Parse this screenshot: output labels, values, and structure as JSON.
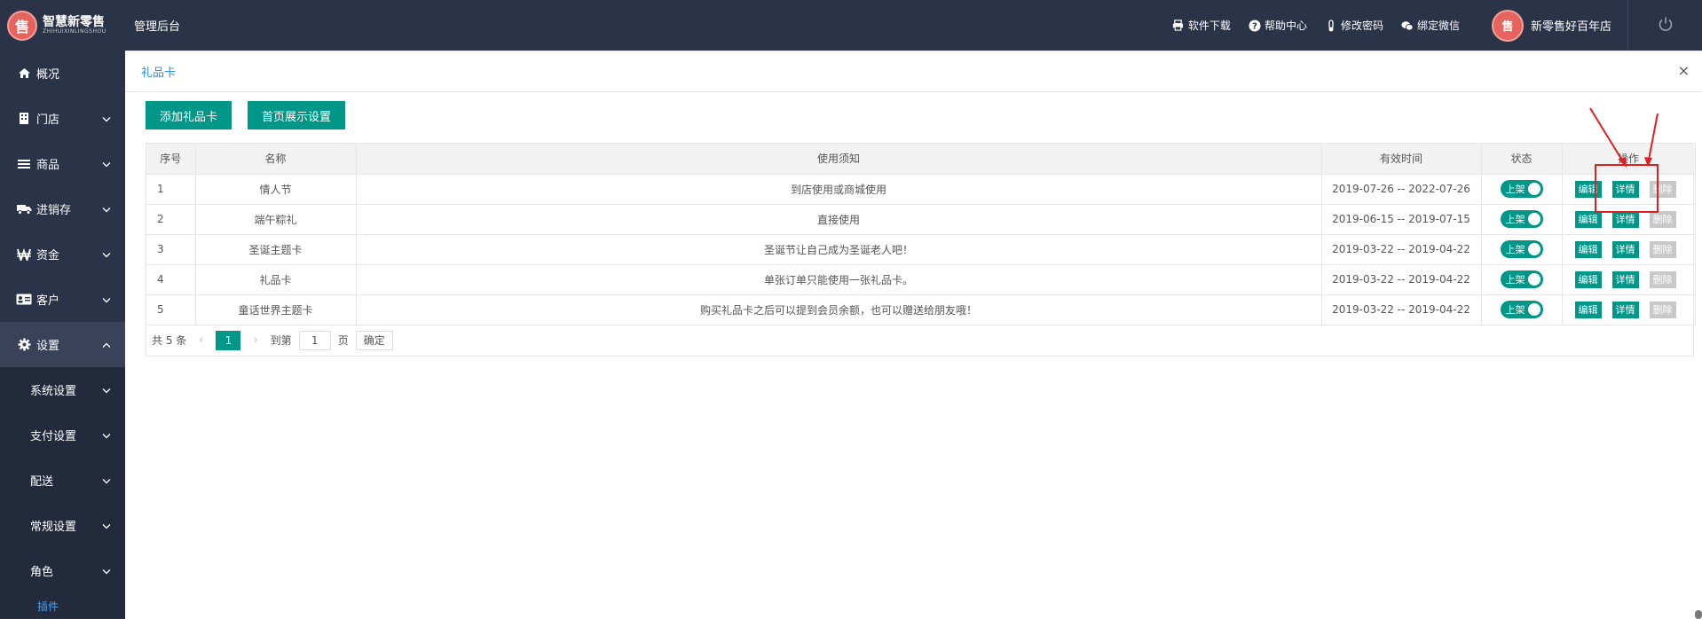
{
  "header": {
    "brand_name": "智慧新零售",
    "brand_sub": "ZHIHUIXINLINGSHOU",
    "logo_glyph": "售",
    "title": "管理后台",
    "links": [
      {
        "label": "软件下载",
        "icon": "printer-icon"
      },
      {
        "label": "帮助中心",
        "icon": "help-icon"
      },
      {
        "label": "修改密码",
        "icon": "thermometer-icon"
      },
      {
        "label": "绑定微信",
        "icon": "wechat-icon"
      }
    ],
    "shop_name": "新零售好百年店"
  },
  "sidebar": {
    "items": [
      {
        "label": "概况",
        "icon": "home-icon"
      },
      {
        "label": "门店",
        "icon": "building-icon"
      },
      {
        "label": "商品",
        "icon": "list-icon"
      },
      {
        "label": "进销存",
        "icon": "truck-icon"
      },
      {
        "label": "资金",
        "icon": "won-icon"
      },
      {
        "label": "客户",
        "icon": "id-card-icon"
      },
      {
        "label": "设置",
        "icon": "gear-icon"
      }
    ],
    "sub_items": [
      {
        "label": "系统设置"
      },
      {
        "label": "支付设置"
      },
      {
        "label": "配送"
      },
      {
        "label": "常规设置"
      },
      {
        "label": "角色"
      }
    ],
    "leaf": "插件"
  },
  "page": {
    "title": "礼品卡",
    "close": "×",
    "buttons": {
      "add": "添加礼品卡",
      "home_display": "首页展示设置"
    }
  },
  "table": {
    "headers": [
      "序号",
      "名称",
      "使用须知",
      "有效时间",
      "状态",
      "操作"
    ],
    "rows": [
      {
        "no": "1",
        "name": "情人节",
        "notice": "到店使用或商城使用",
        "valid": "2019-07-26 -- 2022-07-26",
        "status": "上架"
      },
      {
        "no": "2",
        "name": "端午粽礼",
        "notice": "直接使用",
        "valid": "2019-06-15 -- 2019-07-15",
        "status": "上架"
      },
      {
        "no": "3",
        "name": "圣诞主题卡",
        "notice": "圣诞节让自己成为圣诞老人吧！",
        "valid": "2019-03-22 -- 2019-04-22",
        "status": "上架"
      },
      {
        "no": "4",
        "name": "礼品卡",
        "notice": "单张订单只能使用一张礼品卡。",
        "valid": "2019-03-22 -- 2019-04-22",
        "status": "上架"
      },
      {
        "no": "5",
        "name": "童话世界主题卡",
        "notice": "购买礼品卡之后可以提到会员余额，也可以赠送给朋友哦！",
        "valid": "2019-03-22 -- 2019-04-22",
        "status": "上架"
      }
    ],
    "actions": {
      "edit": "编辑",
      "detail": "详情",
      "delete": "删除"
    }
  },
  "pager": {
    "total": "共 5 条",
    "current": "1",
    "goto_label": "到第",
    "goto_value": "1",
    "page_label": "页",
    "confirm": "确定"
  },
  "colors": {
    "sidebar": "#2b3348",
    "accent": "#009688",
    "title": "#2d8cf0",
    "highlight": "#e02020"
  }
}
